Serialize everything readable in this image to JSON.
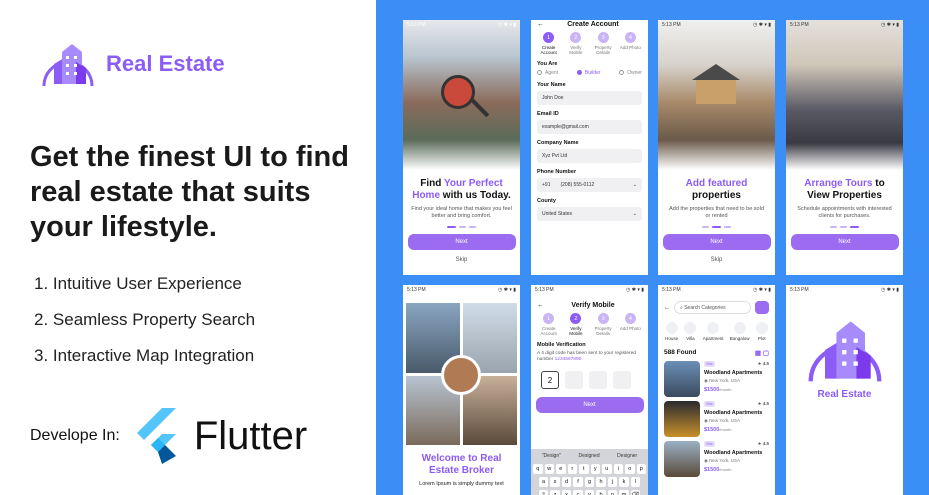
{
  "brand": {
    "name": "Real Estate"
  },
  "headline": "Get the finest UI to find real estate that suits your lifestyle.",
  "features": [
    "1. Intuitive User Experience",
    "2. Seamless Property Search",
    "3. Interactive Map Integration"
  ],
  "develop": {
    "label": "Develope In:",
    "framework": "Flutter"
  },
  "colors": {
    "accent": "#8b5cf6",
    "panel_bg": "#3b8ef5",
    "flutter_light": "#54c5f8",
    "flutter_dark": "#01579b"
  },
  "status_time": "5:13 PM",
  "screens": {
    "onboard1": {
      "title_a": "Find ",
      "title_b": "Your Perfect",
      "title_c": "Home",
      "title_d": " with us Today.",
      "subtitle": "Find your ideal home that makes you feel better and bring comfort.",
      "next": "Next",
      "skip": "Skip"
    },
    "create_account": {
      "title": "Create Account",
      "steps": [
        {
          "n": "1",
          "label": "Create Account"
        },
        {
          "n": "2",
          "label": "Verify Mobile"
        },
        {
          "n": "3",
          "label": "Property Details"
        },
        {
          "n": "4",
          "label": "Add Photo"
        }
      ],
      "you_are": "You Are",
      "roles": [
        "Agent",
        "Builder",
        "Owner"
      ],
      "name_label": "Your Name",
      "name_value": "John Doe",
      "email_label": "Email ID",
      "email_value": "example@gmail.com",
      "company_label": "Company Name",
      "company_value": "Xyz Pvt Ltd",
      "phone_label": "Phone Number",
      "phone_code": "+91",
      "phone_value": "(208) 555-0112",
      "country_label": "County",
      "country_value": "United States"
    },
    "onboard2": {
      "title_a": "Add featured",
      "title_b": "properties",
      "subtitle": "Add the properties that need to be sold or rented",
      "next": "Next",
      "skip": "Skip"
    },
    "onboard3": {
      "title_a": "Arrange Tours",
      "title_b": " to",
      "title_c": "View Properties",
      "subtitle": "Schedule appointments with interested clients for purchases.",
      "next": "Next"
    },
    "welcome": {
      "title_a": "Welcome to Real",
      "title_b": "Estate Broker",
      "body": "Lorem Ipsum is simply dummy text"
    },
    "verify": {
      "title": "Verify Mobile",
      "section": "Mobile Verification",
      "desc": "A 4 digit code has been sent to your registered number ",
      "number": "1234567890",
      "digit1": "2",
      "next": "Next",
      "suggestions": [
        "\"Design\"",
        "Designed",
        "Designer"
      ],
      "row1": [
        "q",
        "w",
        "e",
        "r",
        "t",
        "y",
        "u",
        "i",
        "o",
        "p"
      ],
      "row2": [
        "a",
        "s",
        "d",
        "f",
        "g",
        "h",
        "j",
        "k",
        "l"
      ],
      "row3": [
        "z",
        "x",
        "c",
        "v",
        "b",
        "n",
        "m"
      ]
    },
    "list": {
      "search_placeholder": "Search Categories",
      "categories": [
        "House",
        "Villa",
        "Apartment",
        "Bungalow",
        "Plot"
      ],
      "found": "588 Found",
      "items": [
        {
          "tag": "Villa",
          "rating": "4.5",
          "name": "Woodland Apartments",
          "loc": "New York, USA",
          "price": "$1500",
          "unit": "/month"
        },
        {
          "tag": "Villa",
          "rating": "4.5",
          "name": "Woodland Apartments",
          "loc": "New York, USA",
          "price": "$1500",
          "unit": "/month"
        },
        {
          "tag": "Villa",
          "rating": "4.5",
          "name": "Woodland Apartments",
          "loc": "New York, USA",
          "price": "$1500",
          "unit": "/month"
        }
      ]
    },
    "splash": {
      "name": "Real Estate"
    }
  }
}
